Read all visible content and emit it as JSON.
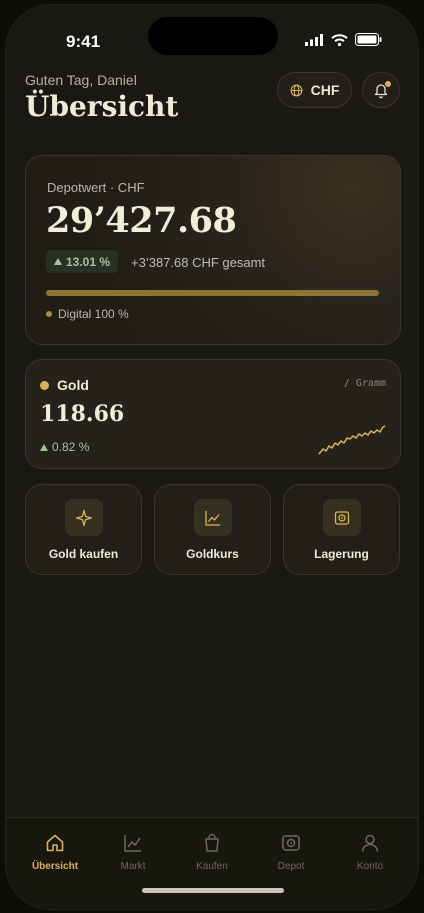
{
  "status_bar": {
    "time": "9:41"
  },
  "header": {
    "greeting": "Guten Tag, Daniel",
    "title": "Übersicht",
    "currency_button": "CHF"
  },
  "portfolio": {
    "label": "Depotwert · CHF",
    "value": "29’427.68",
    "change_pct": "13.01 %",
    "change_abs": "+3’387.68 CHF gesamt",
    "allocation_fraction": 1.0,
    "legend_label": "Digital 100 %"
  },
  "gold": {
    "name": "Gold",
    "unit": "/ Gramm",
    "price": "118.66",
    "change": "0.82 %"
  },
  "actions": [
    {
      "label": "Gold kaufen",
      "icon": "sparkle-icon"
    },
    {
      "label": "Goldkurs",
      "icon": "chart-icon"
    },
    {
      "label": "Lagerung",
      "icon": "vault-icon"
    }
  ],
  "tabs": [
    {
      "label": "Übersicht",
      "icon": "home-icon",
      "active": true
    },
    {
      "label": "Markt",
      "icon": "chart-icon",
      "active": false
    },
    {
      "label": "Kaufen",
      "icon": "bag-icon",
      "active": false
    },
    {
      "label": "Depot",
      "icon": "vault-icon",
      "active": false
    },
    {
      "label": "Konto",
      "icon": "user-icon",
      "active": false
    }
  ],
  "colors": {
    "accent": "#d9b15a",
    "positive": "#a7c29a",
    "background": "#191812"
  }
}
